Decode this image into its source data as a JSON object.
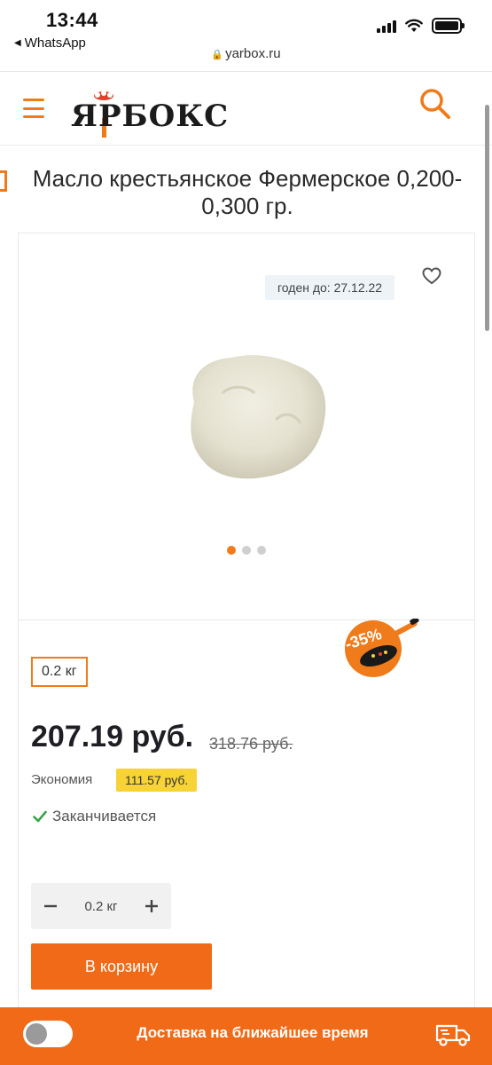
{
  "status_bar": {
    "time": "13:44",
    "back_app": "WhatsApp",
    "url": "yarbox.ru"
  },
  "header": {
    "logo_text": "ЯРБОКС"
  },
  "product": {
    "title": "Масло крестьянское Фермерское 0,200-0,300 гр.",
    "expiry": "годен до: 27.12.22",
    "image_count": 3,
    "active_image": 1,
    "weight": "0.2 кг",
    "discount": "-35%",
    "price": "207.19 руб.",
    "old_price": "318.76 руб.",
    "savings_label": "Экономия",
    "savings_value": "111.57 руб.",
    "stock_status": "Заканчивается",
    "quantity": "0.2 кг",
    "cart_button": "В корзину"
  },
  "bottom_bar": {
    "delivery_text": "Доставка на ближайшее время"
  },
  "colors": {
    "accent": "#f06a17",
    "savings_badge": "#f7d336",
    "stock_check": "#3aa34a"
  },
  "icons": {
    "menu": "hamburger-icon",
    "search": "search-icon",
    "favorite": "heart-icon",
    "stock": "check-icon",
    "delivery": "truck-icon"
  }
}
